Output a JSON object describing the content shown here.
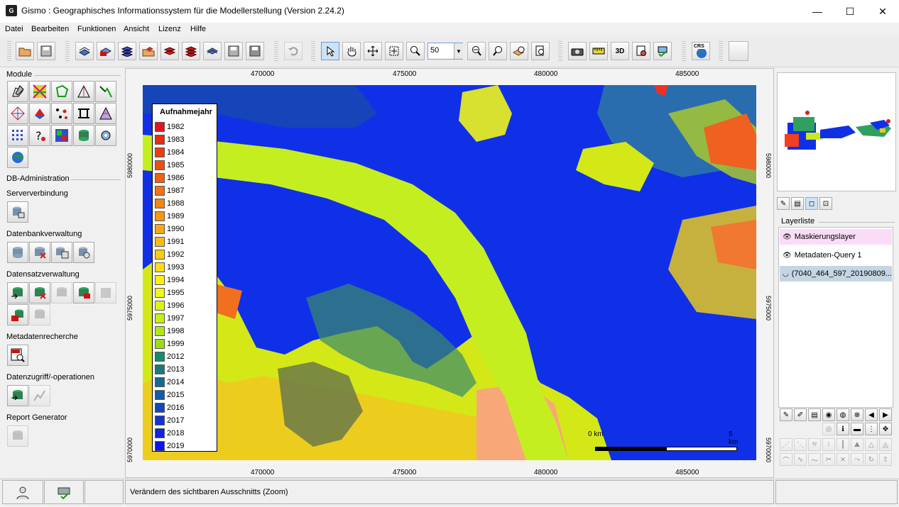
{
  "window": {
    "app_icon": "G",
    "title": "Gismo : Geographisches Informationssystem für die Modellerstellung (Version 2.24.2)",
    "min": "—",
    "max": "☐",
    "close": "✕"
  },
  "menu": [
    "Datei",
    "Bearbeiten",
    "Funktionen",
    "Ansicht",
    "Lizenz",
    "Hilfe"
  ],
  "toolbar": {
    "zoom_value": "50",
    "zoom_dropdown": "▼",
    "crs_label": "CRS",
    "three_d_label": "3D"
  },
  "left": {
    "module_label": "Module",
    "db_admin_label": "DB-Administration",
    "sections": [
      "Serververbindung",
      "Datenbankverwaltung",
      "Datensatzverwaltung",
      "Metadatenrecherche",
      "Datenzugriff/-operationen",
      "Report Generator"
    ]
  },
  "map": {
    "x_ticks": [
      "470000",
      "475000",
      "480000",
      "485000"
    ],
    "y_ticks": [
      "5980000",
      "5975000",
      "5970000"
    ],
    "scale_start": "0 km",
    "scale_end": "5 km"
  },
  "legend": {
    "title": "Aufnahmejahr",
    "entries": [
      {
        "year": "1982",
        "color": "#e8141c"
      },
      {
        "year": "1983",
        "color": "#ea2a14"
      },
      {
        "year": "1984",
        "color": "#ee3c10"
      },
      {
        "year": "1985",
        "color": "#f04e10"
      },
      {
        "year": "1986",
        "color": "#f26010"
      },
      {
        "year": "1987",
        "color": "#f47210"
      },
      {
        "year": "1988",
        "color": "#f68410"
      },
      {
        "year": "1989",
        "color": "#f89612"
      },
      {
        "year": "1990",
        "color": "#faa814"
      },
      {
        "year": "1991",
        "color": "#fcba14"
      },
      {
        "year": "1992",
        "color": "#fccc14"
      },
      {
        "year": "1993",
        "color": "#fcde14"
      },
      {
        "year": "1994",
        "color": "#fcf014"
      },
      {
        "year": "1995",
        "color": "#f0f814"
      },
      {
        "year": "1996",
        "color": "#dcf414"
      },
      {
        "year": "1997",
        "color": "#c8ee14"
      },
      {
        "year": "1998",
        "color": "#b0e614"
      },
      {
        "year": "1999",
        "color": "#98de14"
      },
      {
        "year": "2012",
        "color": "#1a8a6e"
      },
      {
        "year": "2013",
        "color": "#187a80"
      },
      {
        "year": "2014",
        "color": "#166a92"
      },
      {
        "year": "2015",
        "color": "#145aa4"
      },
      {
        "year": "2016",
        "color": "#1248ba"
      },
      {
        "year": "2017",
        "color": "#1036cc"
      },
      {
        "year": "2018",
        "color": "#0e24e0"
      },
      {
        "year": "2019",
        "color": "#0c12f0"
      }
    ]
  },
  "layers": {
    "header": "Layerliste",
    "items": [
      {
        "name": "Maskierungslayer",
        "bg": "#fadcf6",
        "icon": "👁"
      },
      {
        "name": "Metadaten-Query 1",
        "bg": "#ffffff",
        "icon": "👁"
      },
      {
        "name": "(7040_464_597_20190809...",
        "bg": "#c5d5e3",
        "icon": "◡"
      }
    ]
  },
  "status": {
    "message": "Verändern des sichtbaren Ausschnitts (Zoom)"
  }
}
